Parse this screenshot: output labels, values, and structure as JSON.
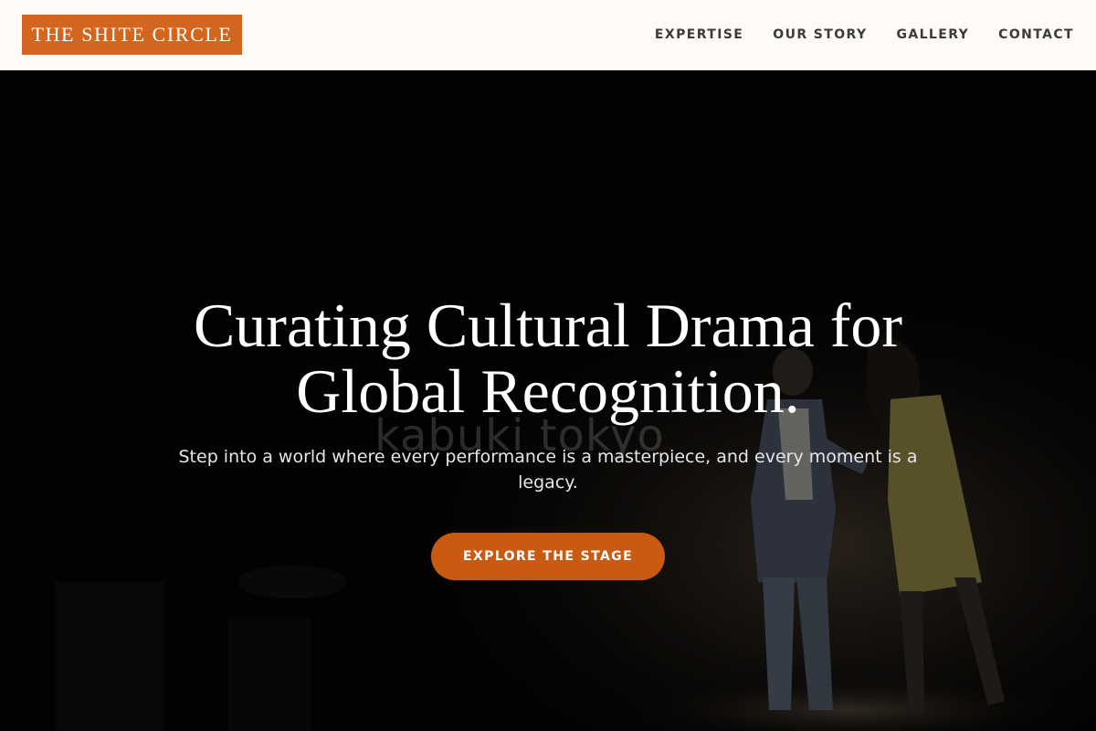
{
  "header": {
    "logo": "THE SHITE CIRCLE",
    "nav": [
      {
        "label": "EXPERTISE"
      },
      {
        "label": "OUR STORY"
      },
      {
        "label": "GALLERY"
      },
      {
        "label": "CONTACT"
      }
    ]
  },
  "hero": {
    "title_line1": "Curating Cultural Drama for",
    "title_line2": "Global Recognition.",
    "subtitle": "Step into a world where every performance is a masterpiece, and every moment is a legacy.",
    "watermark": "kabuki tokyo",
    "cta_label": "EXPLORE THE STAGE"
  },
  "colors": {
    "accent": "#d3661e",
    "button": "#c95a12",
    "header_bg": "#fffbf6",
    "nav_text": "#3b3b3b",
    "hero_bg": "#030303"
  }
}
